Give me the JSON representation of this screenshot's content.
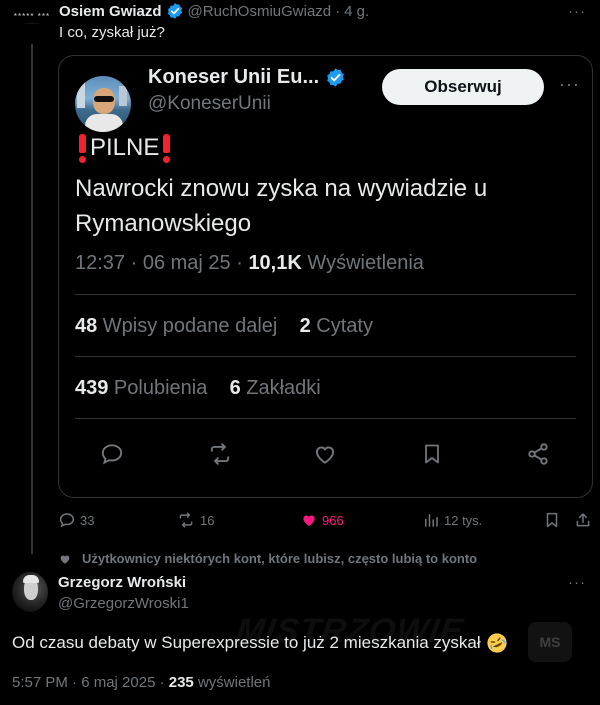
{
  "top_tweet": {
    "avatar_text": "***** ***",
    "avatar_subtext": "............",
    "name": "Osiem Gwiazd",
    "handle": "@RuchOsmiuGwiazd",
    "separator": "·",
    "time": "4 g.",
    "more": "···",
    "text": "I co, zyskał już?",
    "actions": {
      "replies": "33",
      "reposts": "16",
      "likes": "966",
      "views": "12 tys."
    }
  },
  "quoted": {
    "name": "Koneser Unii Eu...",
    "handle": "@KoneserUnii",
    "follow_label": "Obserwuj",
    "more": "···",
    "headline": "PILNE",
    "body": "Nawrocki znowu zyska na wywiadzie u Rymanowskiego",
    "time": "12:37 · 06 maj 25 · ",
    "views_count": "10,1K",
    "views_label": " Wyświetlenia",
    "reposts_count": "48",
    "reposts_label": " Wpisy podane dalej",
    "quotes_count": "2",
    "quotes_label": " Cytaty",
    "likes_count": "439",
    "likes_label": " Polubienia",
    "bookmarks_count": "6",
    "bookmarks_label": " Zakładki"
  },
  "likes_note": "Użytkownicy niektórych kont, które lubisz, często lubią to konto",
  "reply": {
    "name": "Grzegorz Wroński",
    "handle": "@GrzegorzWroski1",
    "more": "···",
    "text": "Od czasu debaty w Superexpressie to już 2 mieszkania zyskał",
    "time": "5:57 PM · 6 maj 2025 · ",
    "views_count": "235",
    "views_label": " wyświetleń"
  },
  "watermark": {
    "text": "MISTRZOWIE",
    "badge": "MS"
  },
  "colors": {
    "background": "#000000",
    "text": "#e7e9ea",
    "muted": "#71767b",
    "verified": "#1d9bf0",
    "like_active": "#f91880",
    "border": "#2f3336"
  }
}
